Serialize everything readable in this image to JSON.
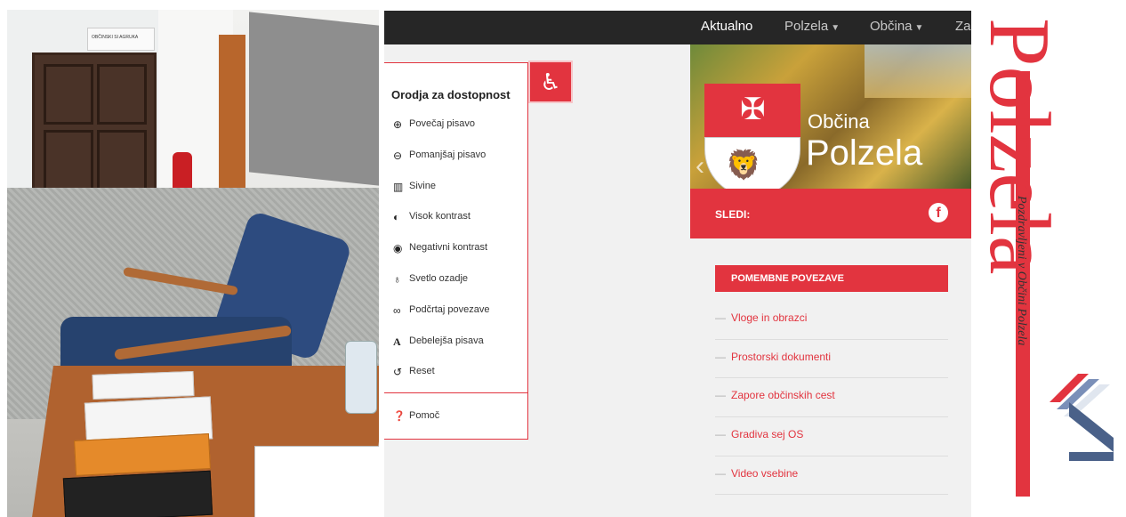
{
  "photo": {
    "sign_text": "OBČINSKI SI AGRUKA"
  },
  "site": {
    "nav": [
      {
        "label": "Aktualno",
        "has_caret": false
      },
      {
        "label": "Polzela",
        "has_caret": true
      },
      {
        "label": "Občina",
        "has_caret": true
      },
      {
        "label": "Za",
        "has_caret": false
      }
    ],
    "accessibility": {
      "title": "Orodja za dostopnost",
      "toggle_icon": "wheelchair-icon",
      "items": [
        {
          "icon": "zoom-in-icon",
          "label": "Povečaj pisavo"
        },
        {
          "icon": "zoom-out-icon",
          "label": "Pomanjšaj pisavo"
        },
        {
          "icon": "grayscale-icon",
          "label": "Sivine"
        },
        {
          "icon": "contrast-icon",
          "label": "Visok kontrast"
        },
        {
          "icon": "eye-icon",
          "label": "Negativni kontrast"
        },
        {
          "icon": "lightbulb-icon",
          "label": "Svetlo ozadje"
        },
        {
          "icon": "link-icon",
          "label": "Podčrtaj povezave"
        },
        {
          "icon": "font-icon",
          "label": "Debelejša pisava"
        },
        {
          "icon": "reset-icon",
          "label": "Reset"
        }
      ],
      "help": {
        "icon": "question-icon",
        "label": "Pomoč"
      }
    },
    "hero": {
      "line1": "Občina",
      "line2": "Polzela"
    },
    "follow": {
      "label": "SLEDI:",
      "icon": "facebook-icon"
    },
    "important_links": {
      "title": "POMEMBNE POVEZAVE",
      "items": [
        "Vloge in obrazci",
        "Prostorski dokumenti",
        "Zapore občinskih cest",
        "Gradiva sej OS",
        "Video vsebine"
      ]
    }
  },
  "logo": {
    "word": "Polzela",
    "slogan": "Pozdravljeni v Občini Polzela"
  },
  "colors": {
    "accent_red": "#e2343f",
    "nav_dark": "#262626"
  }
}
